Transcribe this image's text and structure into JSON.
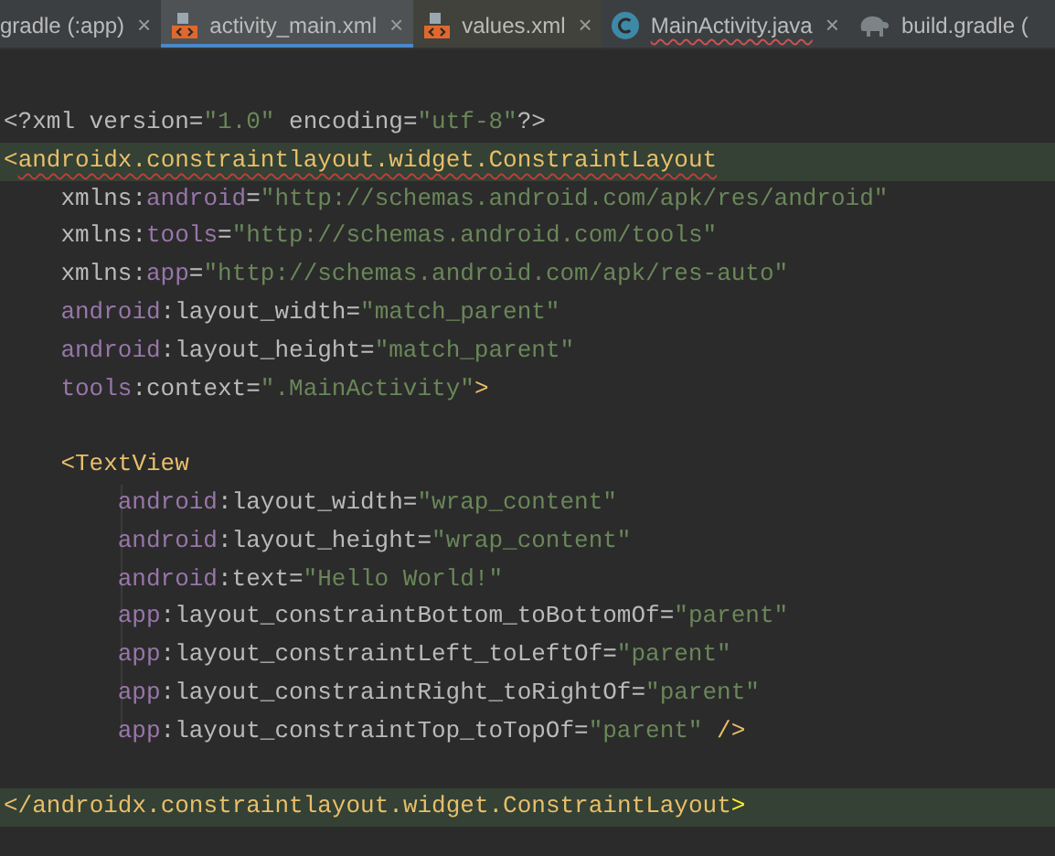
{
  "tabs": [
    {
      "label": "gradle (:app)",
      "kind": "plain",
      "close": "×",
      "selected": false,
      "error_underline": false
    },
    {
      "label": "activity_main.xml",
      "kind": "xml",
      "close": "×",
      "selected": true,
      "error_underline": false
    },
    {
      "label": "values.xml",
      "kind": "xml",
      "close": "×",
      "selected": false,
      "error_underline": false
    },
    {
      "label": "MainActivity.java",
      "kind": "class",
      "close": "×",
      "selected": false,
      "error_underline": true
    },
    {
      "label": "build.gradle (",
      "kind": "gradle",
      "selected": false,
      "error_underline": false
    }
  ],
  "code_lines": [
    {
      "highlighted": false,
      "segments": [
        {
          "text": "<?xml version=",
          "kind": "text"
        },
        {
          "text": "\"1.0\"",
          "kind": "value"
        },
        {
          "text": " encoding=",
          "kind": "text"
        },
        {
          "text": "\"utf-8\"",
          "kind": "value"
        },
        {
          "text": "?>",
          "kind": "text"
        }
      ]
    },
    {
      "highlighted": true,
      "segments": [
        {
          "text": "<",
          "kind": "tag"
        },
        {
          "text": "androidx.constraintlayout.widget.ConstraintLayout",
          "kind": "tag",
          "error_underline": true
        }
      ],
      "children": [
        {
          "highlighted": false,
          "segments": [
            {
              "text": "xmlns:",
              "kind": "text"
            },
            {
              "text": "android",
              "kind": "ns"
            },
            {
              "text": "=",
              "kind": "text"
            },
            {
              "text": "\"http://schemas.android.com/apk/res/android\"",
              "kind": "value"
            }
          ]
        },
        {
          "highlighted": false,
          "segments": [
            {
              "text": "xmlns:",
              "kind": "text"
            },
            {
              "text": "tools",
              "kind": "ns"
            },
            {
              "text": "=",
              "kind": "text"
            },
            {
              "text": "\"http://schemas.android.com/tools\"",
              "kind": "value"
            }
          ]
        },
        {
          "highlighted": false,
          "segments": [
            {
              "text": "xmlns:",
              "kind": "text"
            },
            {
              "text": "app",
              "kind": "ns"
            },
            {
              "text": "=",
              "kind": "text"
            },
            {
              "text": "\"http://schemas.android.com/apk/res-auto\"",
              "kind": "value"
            }
          ]
        },
        {
          "highlighted": false,
          "segments": [
            {
              "text": "android",
              "kind": "ns"
            },
            {
              "text": ":layout_width=",
              "kind": "text"
            },
            {
              "text": "\"match_parent\"",
              "kind": "value"
            }
          ]
        },
        {
          "highlighted": false,
          "segments": [
            {
              "text": "android",
              "kind": "ns"
            },
            {
              "text": ":layout_height=",
              "kind": "text"
            },
            {
              "text": "\"match_parent\"",
              "kind": "value"
            }
          ]
        },
        {
          "highlighted": false,
          "segments": [
            {
              "text": "tools",
              "kind": "ns"
            },
            {
              "text": ":context=",
              "kind": "text"
            },
            {
              "text": "\".MainActivity\"",
              "kind": "value"
            },
            {
              "text": ">",
              "kind": "tag"
            }
          ]
        },
        {
          "highlighted": false,
          "gap_before": true,
          "segments": [
            {
              "text": "<TextView",
              "kind": "tag"
            }
          ],
          "children": [
            {
              "highlighted": false,
              "segments": [
                {
                  "text": "android",
                  "kind": "ns"
                },
                {
                  "text": ":layout_width=",
                  "kind": "text"
                },
                {
                  "text": "\"wrap_content\"",
                  "kind": "value"
                }
              ]
            },
            {
              "highlighted": false,
              "segments": [
                {
                  "text": "android",
                  "kind": "ns"
                },
                {
                  "text": ":layout_height=",
                  "kind": "text"
                },
                {
                  "text": "\"wrap_content\"",
                  "kind": "value"
                }
              ]
            },
            {
              "highlighted": false,
              "segments": [
                {
                  "text": "android",
                  "kind": "ns"
                },
                {
                  "text": ":text=",
                  "kind": "text"
                },
                {
                  "text": "\"Hello World!\"",
                  "kind": "value"
                }
              ]
            },
            {
              "highlighted": false,
              "segments": [
                {
                  "text": "app",
                  "kind": "ns"
                },
                {
                  "text": ":layout_constraintBottom_toBottomOf=",
                  "kind": "text"
                },
                {
                  "text": "\"parent\"",
                  "kind": "value"
                }
              ]
            },
            {
              "highlighted": false,
              "segments": [
                {
                  "text": "app",
                  "kind": "ns"
                },
                {
                  "text": ":layout_constraintLeft_toLeftOf=",
                  "kind": "text"
                },
                {
                  "text": "\"parent\"",
                  "kind": "value"
                }
              ]
            },
            {
              "highlighted": false,
              "segments": [
                {
                  "text": "app",
                  "kind": "ns"
                },
                {
                  "text": ":layout_constraintRight_toRightOf=",
                  "kind": "text"
                },
                {
                  "text": "\"parent\"",
                  "kind": "value"
                }
              ]
            },
            {
              "highlighted": false,
              "segments": [
                {
                  "text": "app",
                  "kind": "ns"
                },
                {
                  "text": ":layout_constraintTop_toTopOf=",
                  "kind": "text"
                },
                {
                  "text": "\"parent\"",
                  "kind": "value"
                },
                {
                  "text": " />",
                  "kind": "tag"
                }
              ]
            }
          ]
        }
      ]
    },
    {
      "highlighted": true,
      "gap_before": true,
      "segments": [
        {
          "text": "</",
          "kind": "tag"
        },
        {
          "text": "androidx.constraintlayout.widget.ConstraintLayout",
          "kind": "tag"
        },
        {
          "text": ">",
          "kind": "bracket"
        }
      ]
    }
  ]
}
